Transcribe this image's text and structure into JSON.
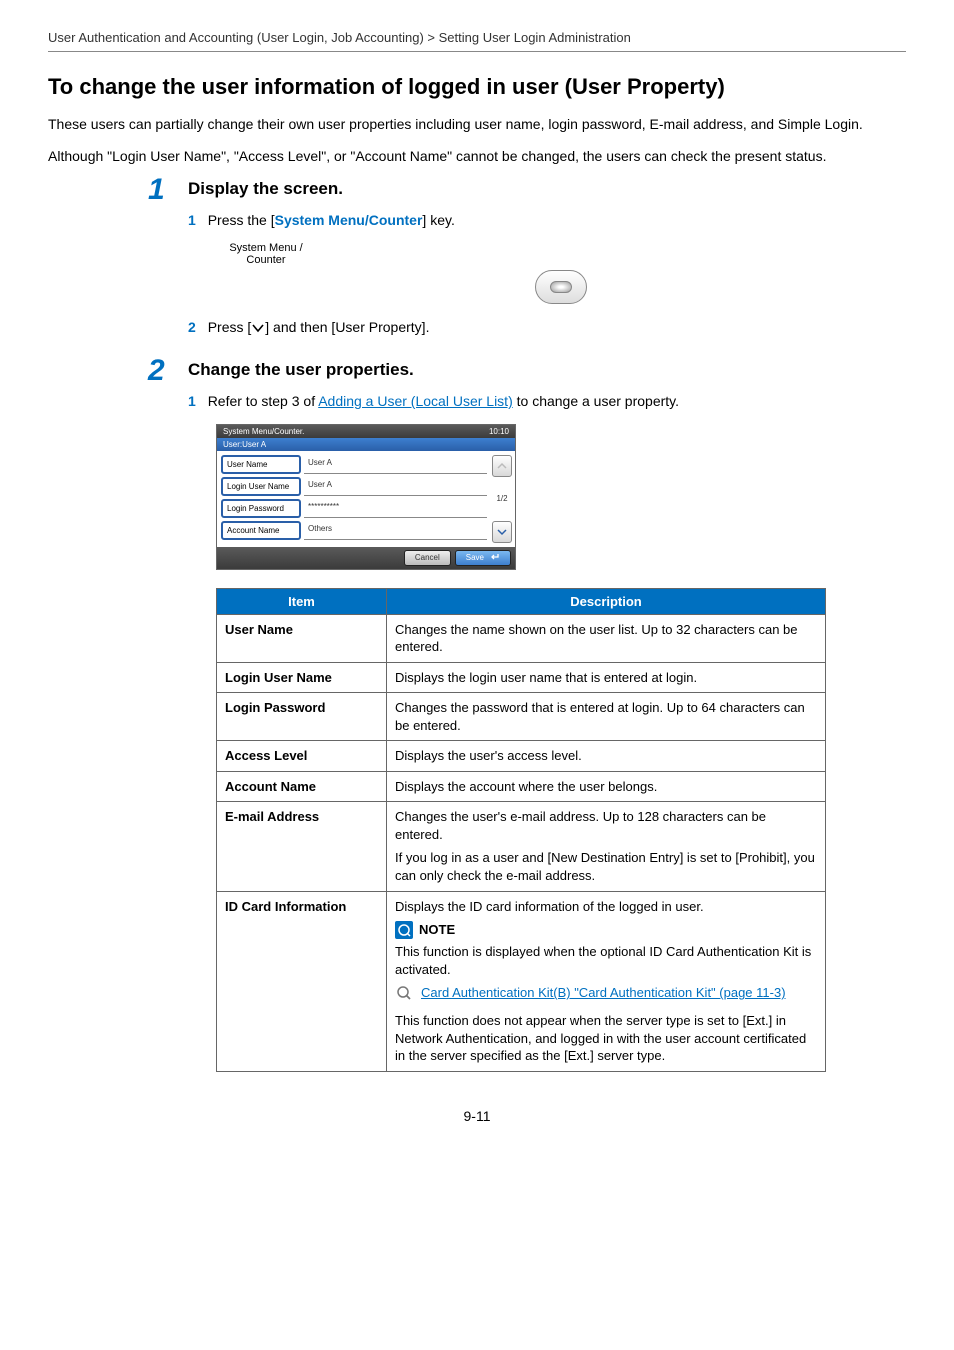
{
  "breadcrumb": "User Authentication and Accounting (User Login, Job Accounting) > Setting User Login Administration",
  "heading": "To change the user information of logged in user (User Property)",
  "intro": {
    "p1": "These users can partially change their own user properties including user name, login password, E-mail address, and Simple Login.",
    "p2": "Although \"Login User Name\", \"Access Level\", or \"Account Name\" cannot be changed, the users can check the present status."
  },
  "step1": {
    "num": "1",
    "title": "Display the screen.",
    "sub1": {
      "num": "1",
      "pre": "Press the [",
      "key": "System Menu/Counter",
      "post": "] key."
    },
    "hw": {
      "line1": "System Menu /",
      "line2": "Counter"
    },
    "sub2": {
      "num": "2",
      "pre": "Press [",
      "post": "] and then [User Property]."
    }
  },
  "step2": {
    "num": "2",
    "title": "Change the user properties.",
    "sub1": {
      "num": "1",
      "pre": "Refer to step 3 of ",
      "link": "Adding a User (Local User List)",
      "post": " to change a user property."
    }
  },
  "device": {
    "title": "System Menu/Counter.",
    "time": "10:10",
    "subtitle": "User:User A",
    "rows": [
      {
        "label": "User Name",
        "value": "User A"
      },
      {
        "label": "Login User Name",
        "value": "User A"
      },
      {
        "label": "Login Password",
        "value": "**********"
      },
      {
        "label": "Account Name",
        "value": "Others"
      }
    ],
    "page": "1/2",
    "cancel": "Cancel",
    "save": "Save"
  },
  "table": {
    "head": {
      "item": "Item",
      "desc": "Description"
    },
    "rows": [
      {
        "item": "User Name",
        "desc": "Changes the name shown on the user list. Up to 32 characters can be entered."
      },
      {
        "item": "Login User Name",
        "desc": "Displays the login user name that is entered at login."
      },
      {
        "item": "Login Password",
        "desc": "Changes the password that is entered at login. Up to 64 characters can be entered."
      },
      {
        "item": "Access Level",
        "desc": "Displays the user's access level."
      },
      {
        "item": "Account Name",
        "desc": "Displays the account where the user belongs."
      },
      {
        "item": "E-mail Address",
        "desc1": "Changes the user's e-mail address. Up to 128 characters can be entered.",
        "desc2": "If you log in as a user and [New Destination Entry] is set to [Prohibit], you can only check the e-mail address."
      },
      {
        "item": "ID Card Information",
        "desc1": "Displays the ID card information of the logged in user.",
        "note_label": "NOTE",
        "note_body": "This function is displayed when the optional ID Card Authentication Kit is activated.",
        "xref": "Card Authentication Kit(B) \"Card Authentication Kit\" (page 11-3)",
        "tail": "This function does not appear when the server type is set to [Ext.] in Network Authentication, and logged in with the user account certificated in the server specified as the [Ext.] server type."
      }
    ]
  },
  "page_number": "9-11"
}
